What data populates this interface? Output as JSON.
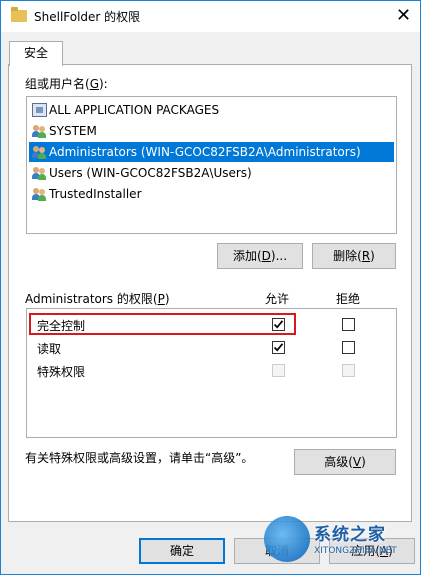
{
  "window": {
    "title": "ShellFolder 的权限",
    "close_glyph": "✕"
  },
  "tabs": [
    {
      "label": "安全",
      "selected": true
    }
  ],
  "groups": {
    "label": "组或用户名(",
    "accel": "G",
    "label_end": "):",
    "items": [
      {
        "label": "ALL APPLICATION PACKAGES",
        "icon": "package-icon",
        "selected": false
      },
      {
        "label": "SYSTEM",
        "icon": "users-icon",
        "selected": false
      },
      {
        "label": "Administrators (WIN-GCOC82FSB2A\\Administrators)",
        "icon": "users-icon",
        "selected": true
      },
      {
        "label": "Users (WIN-GCOC82FSB2A\\Users)",
        "icon": "users-icon",
        "selected": false
      },
      {
        "label": "TrustedInstaller",
        "icon": "users-icon",
        "selected": false
      }
    ]
  },
  "buttons": {
    "add": {
      "text": "添加(",
      "accel": "D",
      "end": ")..."
    },
    "remove": {
      "text": "删除(",
      "accel": "R",
      "end": ")"
    },
    "advanced": {
      "text": "高级(",
      "accel": "V",
      "end": ")"
    },
    "ok": "确定",
    "cancel": "取消",
    "apply": {
      "text": "应用(",
      "accel": "A",
      "end": ")"
    }
  },
  "permissions": {
    "label": "Administrators 的权限(",
    "accel": "P",
    "label_end": ")",
    "allow_header": "允许",
    "deny_header": "拒绝",
    "rows": [
      {
        "name": "完全控制",
        "allow": true,
        "deny": false,
        "enabled": true,
        "highlighted": true
      },
      {
        "name": "读取",
        "allow": true,
        "deny": false,
        "enabled": true,
        "highlighted": false
      },
      {
        "name": "特殊权限",
        "allow": false,
        "deny": false,
        "enabled": false,
        "highlighted": false
      }
    ]
  },
  "advanced_hint": "有关特殊权限或高级设置，请单击“高级”。",
  "watermark": {
    "name": "系统之家",
    "url": "XITONGZHIJIA.NET"
  },
  "colors": {
    "accent": "#0078d7",
    "highlight_border": "#d6181f",
    "window_border": "#1883d7"
  }
}
